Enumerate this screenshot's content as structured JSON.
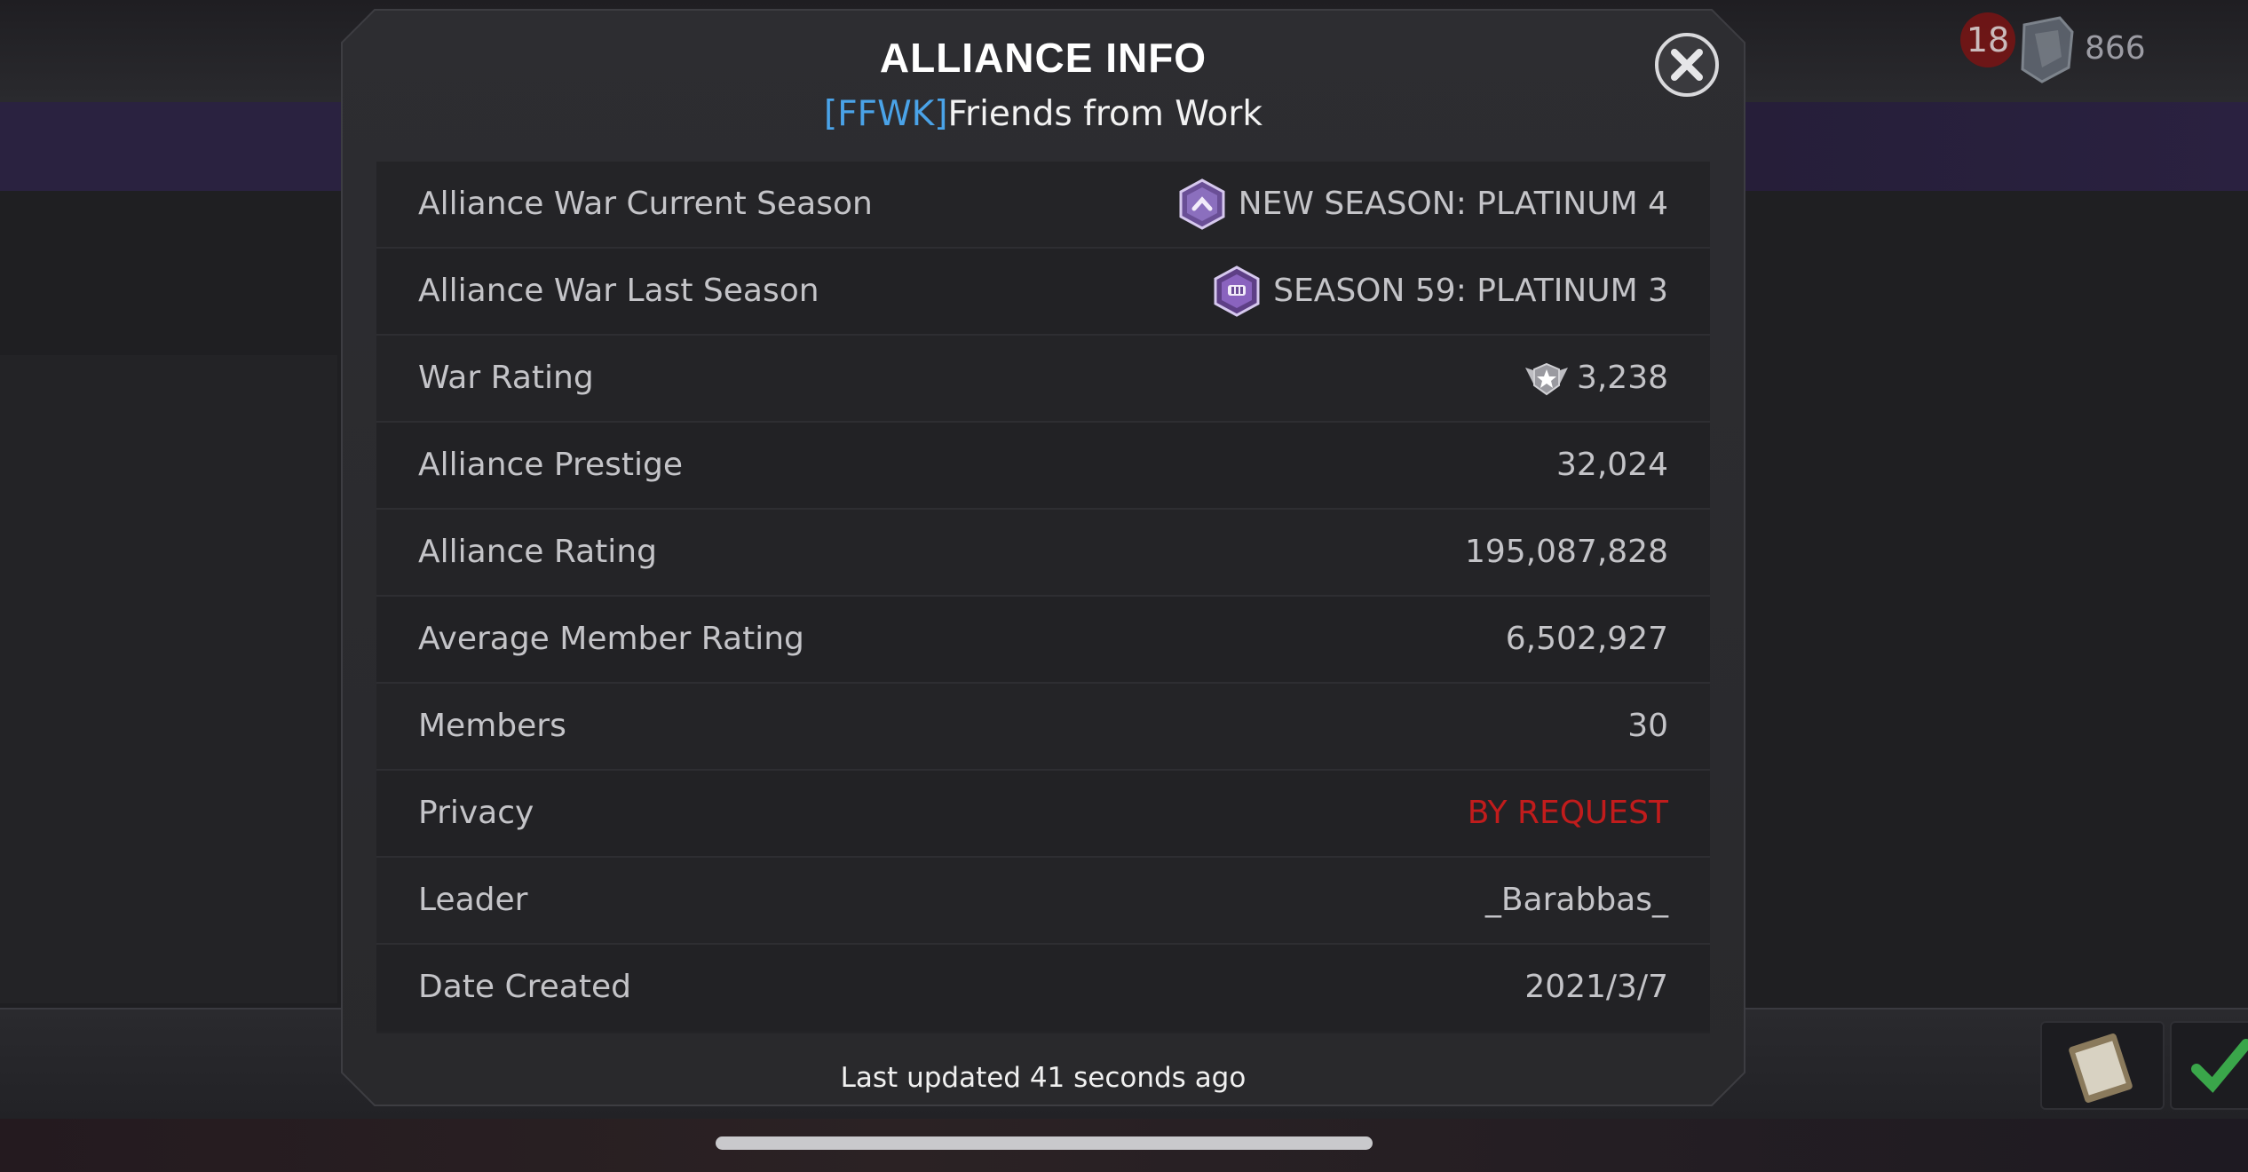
{
  "hud": {
    "notification_count": "18",
    "currency_count": "866"
  },
  "modal": {
    "title": "ALLIANCE INFO",
    "alliance_tag": "[FFWK]",
    "alliance_name": "Friends from Work",
    "close_icon": "close-x-icon",
    "rows": [
      {
        "label": "Alliance War Current Season",
        "value": "NEW SEASON: PLATINUM 4",
        "icon": "platinum-season-badge-icon"
      },
      {
        "label": "Alliance War Last Season",
        "value": "SEASON 59: PLATINUM 3",
        "icon": "platinum-3-season-badge-icon"
      },
      {
        "label": "War Rating",
        "value": "3,238",
        "icon": "war-rating-star-icon"
      },
      {
        "label": "Alliance Prestige",
        "value": "32,024"
      },
      {
        "label": "Alliance Rating",
        "value": "195,087,828"
      },
      {
        "label": "Average Member Rating",
        "value": "6,502,927"
      },
      {
        "label": "Members",
        "value": "30"
      },
      {
        "label": "Privacy",
        "value": "BY REQUEST",
        "color": "#c11c1c"
      },
      {
        "label": "Leader",
        "value": "_Barabbas_"
      },
      {
        "label": "Date Created",
        "value": "2021/3/7"
      }
    ],
    "footer": "Last updated 41 seconds ago"
  },
  "colors": {
    "tag": "#4aa3e8",
    "privacy": "#c11c1c",
    "panel": "#2d2d31"
  }
}
